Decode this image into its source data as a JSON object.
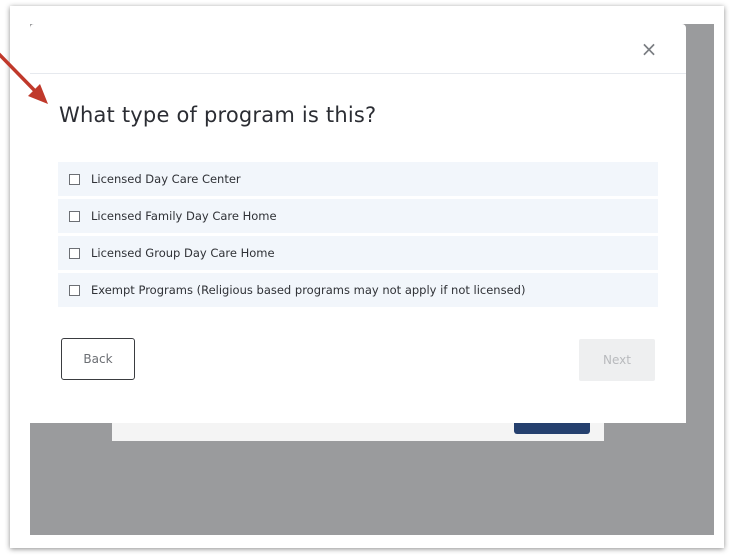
{
  "modal": {
    "close_icon": "×",
    "title": "What type of program is this?",
    "options": [
      {
        "label": "Licensed Day Care Center",
        "checked": false
      },
      {
        "label": "Licensed Family Day Care Home",
        "checked": false
      },
      {
        "label": "Licensed Group Day Care Home",
        "checked": false
      },
      {
        "label": "Exempt Programs (Religious based programs may not apply if not licensed)",
        "checked": false
      }
    ],
    "back_label": "Back",
    "next_label": "Next",
    "next_disabled": true
  },
  "annotation": {
    "arrow_color": "#c0392b",
    "icon": "arrow-pointer-icon"
  },
  "colors": {
    "overlay": "#9a9b9d",
    "option_bg": "#f2f6fb",
    "behind_button": "#25406e"
  }
}
